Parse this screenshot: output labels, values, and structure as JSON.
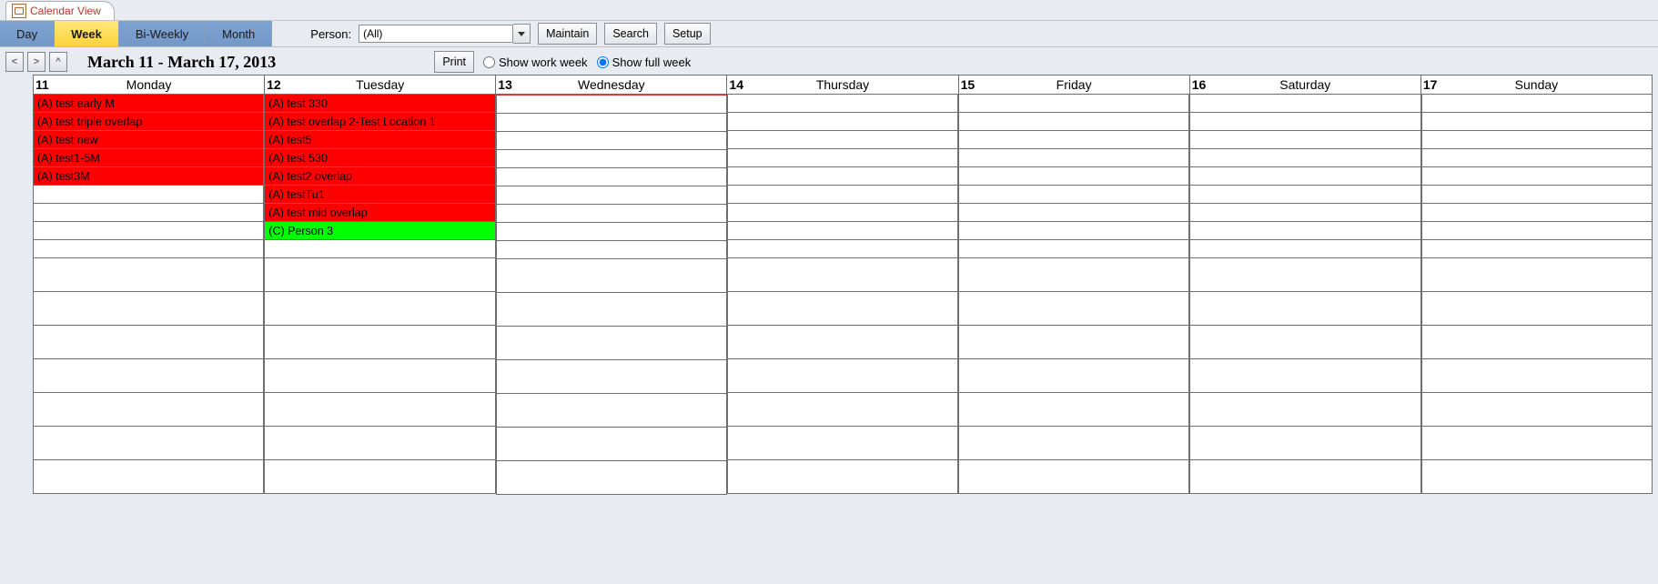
{
  "tab": {
    "title": "Calendar View"
  },
  "views": {
    "day": "Day",
    "week": "Week",
    "biweekly": "Bi-Weekly",
    "month": "Month",
    "active": "week"
  },
  "person": {
    "label": "Person:",
    "value": "(All)"
  },
  "toolbarButtons": {
    "maintain": "Maintain",
    "search": "Search",
    "setup": "Setup"
  },
  "nav": {
    "prev": "<",
    "next": ">",
    "up": "^"
  },
  "dateRange": "March 11 - March 17, 2013",
  "printLabel": "Print",
  "weekMode": {
    "work": "Show work week",
    "full": "Show full week",
    "selected": "full"
  },
  "days": [
    {
      "num": "11",
      "label": "Monday"
    },
    {
      "num": "12",
      "label": "Tuesday"
    },
    {
      "num": "13",
      "label": "Wednesday"
    },
    {
      "num": "14",
      "label": "Thursday"
    },
    {
      "num": "15",
      "label": "Friday"
    },
    {
      "num": "16",
      "label": "Saturday"
    },
    {
      "num": "17",
      "label": "Sunday"
    }
  ],
  "mondayEvents": [
    {
      "text": "(A) test early M",
      "color": "red"
    },
    {
      "text": "(A) test triple overlap",
      "color": "red"
    },
    {
      "text": "(A) test new",
      "color": "red"
    },
    {
      "text": "(A) test1-5M",
      "color": "red"
    },
    {
      "text": "(A) test3M",
      "color": "red"
    }
  ],
  "tuesdayEvents": [
    {
      "text": "(A) test 330",
      "color": "red"
    },
    {
      "text": "(A) test overlap 2-Test Location 1",
      "color": "red"
    },
    {
      "text": "(A) test5",
      "color": "red"
    },
    {
      "text": "(A) test 530",
      "color": "red"
    },
    {
      "text": "(A) test2 overlap",
      "color": "red"
    },
    {
      "text": "(A) testTu1",
      "color": "red"
    },
    {
      "text": "(A) test mid overlap",
      "color": "red"
    },
    {
      "text": "(C) Person 3",
      "color": "green"
    }
  ]
}
